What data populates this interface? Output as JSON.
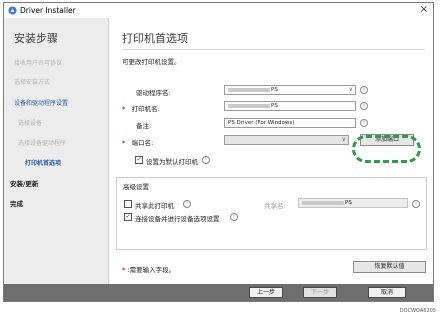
{
  "window": {
    "title": "Driver Installer",
    "close_glyph": "×"
  },
  "sidebar": {
    "title": "安装步骤",
    "items": [
      {
        "label": "接收用户许可协议",
        "state": "done"
      },
      {
        "label": "选择安装方式",
        "state": "done"
      },
      {
        "label": "设备和驱动程序设置",
        "state": "group"
      },
      {
        "label": "选择设备",
        "state": "sub"
      },
      {
        "label": "选择设备驱动程序",
        "state": "sub"
      },
      {
        "label": "打印机首选项",
        "state": "current"
      },
      {
        "label": "安装/更新",
        "state": "pending"
      },
      {
        "label": "完成",
        "state": "pending"
      }
    ]
  },
  "main": {
    "title": "打印机首选项",
    "description": "可更改打印机设置。",
    "fields": {
      "driver": {
        "label": "驱动程序名:",
        "value_suffix": "PS",
        "dropdown_glyph": "∨"
      },
      "printer": {
        "label": "打印机名:",
        "required_mark": "*",
        "value_suffix": "PS"
      },
      "comment": {
        "label": "备注:",
        "value": "PS Driver (For Windows)"
      },
      "port": {
        "label": "端口名:",
        "required_mark": "*",
        "add_port_button": "添加端口"
      }
    },
    "default_printer": {
      "label": "设置为默认打印机",
      "checked": true
    },
    "advanced": {
      "title": "高级设置",
      "share": {
        "label": "共享此打印机",
        "checked": false
      },
      "share_name_label": "共享名:",
      "share_name_suffix": "PS",
      "auto_config": {
        "label": "连接设备并进行设备选项设置",
        "checked": true
      }
    },
    "required_note_mark": "*",
    "required_note": ":需要输入字段。",
    "restore_defaults": "恢复默认值",
    "info_glyph": "i"
  },
  "nav": {
    "back": "上一步",
    "next": "下一步",
    "cancel": "取消"
  },
  "caption": "DOCWOA6205",
  "colors": {
    "accent": "#2c5fa6",
    "required": "#d02020",
    "highlight": "#2e9a4a"
  }
}
